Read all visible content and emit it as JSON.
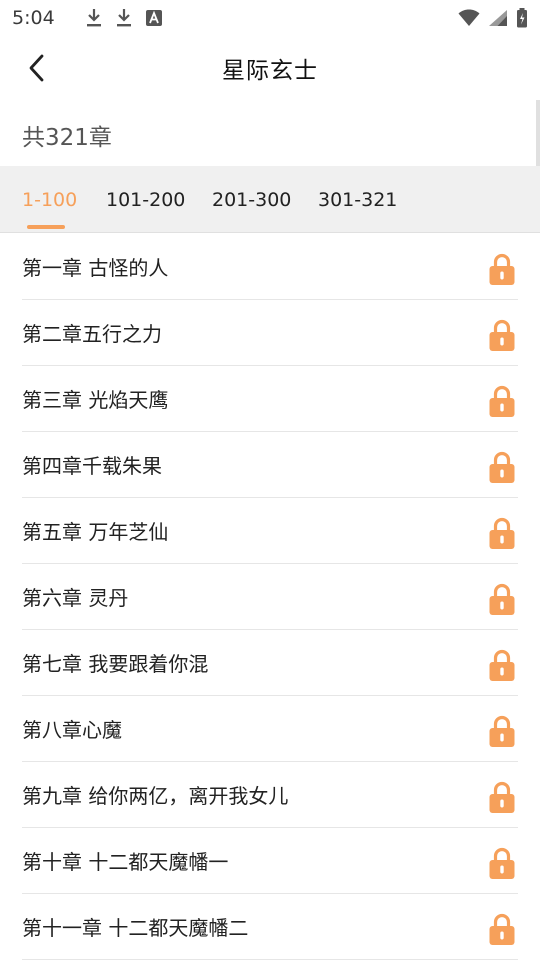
{
  "status_bar": {
    "time": "5:04",
    "left_icons": [
      "download-icon",
      "download-icon",
      "text-a-icon"
    ],
    "right_icons": [
      "wifi-icon",
      "signal-icon",
      "battery-icon"
    ]
  },
  "header": {
    "title": "星际玄士",
    "back_icon": "chevron-left-icon"
  },
  "chapter_count": "共321章",
  "tabs": [
    {
      "label": "1-100",
      "active": true
    },
    {
      "label": "101-200",
      "active": false
    },
    {
      "label": "201-300",
      "active": false
    },
    {
      "label": "301-321",
      "active": false
    }
  ],
  "chapters": [
    {
      "title": "第一章 古怪的人",
      "icon": "lock-icon"
    },
    {
      "title": "第二章五行之力",
      "icon": "lock-icon"
    },
    {
      "title": "第三章 光焰天鹰",
      "icon": "lock-icon"
    },
    {
      "title": "第四章千载朱果",
      "icon": "lock-icon"
    },
    {
      "title": "第五章 万年芝仙",
      "icon": "lock-icon"
    },
    {
      "title": "第六章 灵丹",
      "icon": "lock-icon"
    },
    {
      "title": "第七章 我要跟着你混",
      "icon": "lock-icon"
    },
    {
      "title": "第八章心魔",
      "icon": "lock-icon"
    },
    {
      "title": "第九章 给你两亿，离开我女儿",
      "icon": "lock-icon"
    },
    {
      "title": "第十章 十二都天魔幡一",
      "icon": "lock-icon"
    },
    {
      "title": "第十一章 十二都天魔幡二",
      "icon": "lock-icon"
    }
  ],
  "colors": {
    "accent": "#f6a05a",
    "tab_bar_bg": "#f0f0f0",
    "divider": "#e6e6e6"
  }
}
